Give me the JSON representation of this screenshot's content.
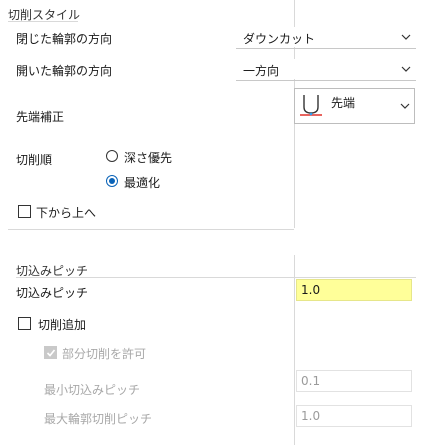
{
  "cutting_style": {
    "section_title": "切削スタイル",
    "row1": {
      "label": "閉じた輪郭の方向",
      "value": "ダウンカット"
    },
    "row2": {
      "label": "開いた輪郭の方向",
      "value": "一方向"
    },
    "row3": {
      "label": "先端補正",
      "value": "先端"
    },
    "order": {
      "label": "切削順",
      "options": [
        "深さ優先",
        "最適化"
      ],
      "selected": "最適化"
    },
    "bottom_up": {
      "label": "下から上へ",
      "checked": false
    }
  },
  "stepdown": {
    "section_title": "切込みピッチ",
    "pitch": {
      "label": "切込みピッチ",
      "value": "1.0"
    },
    "add_cut": {
      "label": "切削追加",
      "checked": false
    },
    "partial": {
      "label": "部分切削を許可",
      "checked": true,
      "enabled": false
    },
    "min_step": {
      "label": "最小切込みピッチ",
      "value": "0.1"
    },
    "max_contour": {
      "label": "最大輪郭切削ピッチ",
      "value": "1.0"
    }
  },
  "colors": {
    "accent": "#0a63b8",
    "highlight_field": "#ffff99",
    "tool_red": "#e0302a"
  }
}
